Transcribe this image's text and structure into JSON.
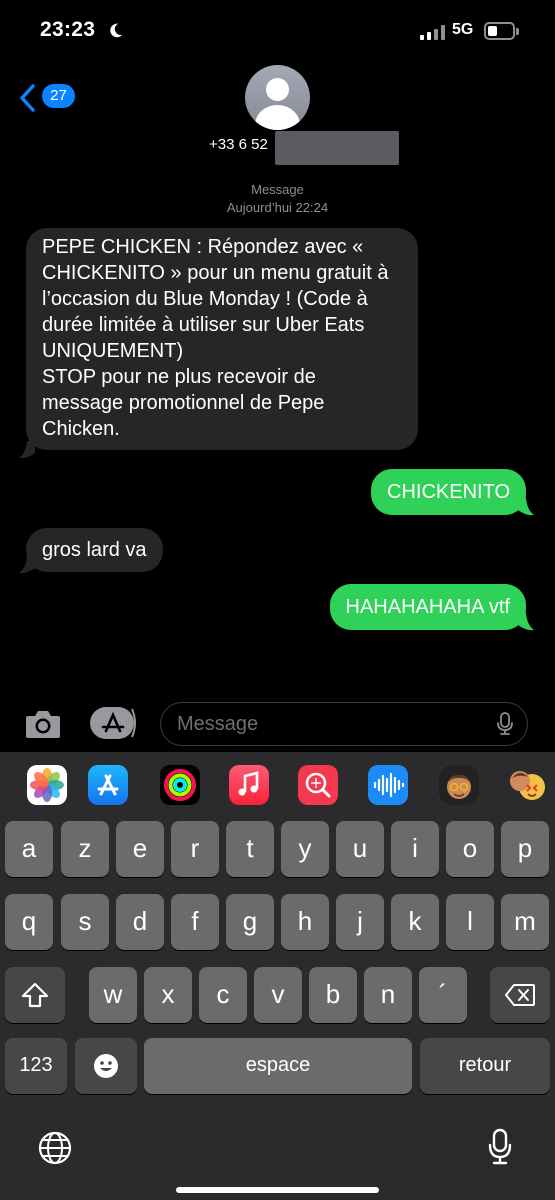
{
  "status_bar": {
    "time": "23:23",
    "network": "5G"
  },
  "header": {
    "unread_count": "27",
    "contact_number": "+33 6 52"
  },
  "thread": {
    "service": "Message",
    "timestamp": "Aujourd’hui 22:24",
    "messages": [
      {
        "direction": "incoming",
        "text": "PEPE CHICKEN : Répondez avec « CHICKENITO » pour un menu gratuit à l’occasion du Blue Monday ! (Code à durée limitée à utiliser sur Uber Eats UNIQUEMENT)\nSTOP pour ne plus recevoir de message promotionnel de Pepe Chicken."
      },
      {
        "direction": "outgoing",
        "text": "CHICKENITO"
      },
      {
        "direction": "incoming",
        "text": "gros lard va"
      },
      {
        "direction": "outgoing",
        "text": "HAHAHAHAHA vtf"
      }
    ]
  },
  "compose": {
    "placeholder": "Message"
  },
  "app_strip": [
    "photos-icon",
    "app-store-icon",
    "activity-icon",
    "music-icon",
    "images-search-icon",
    "audio-message-icon",
    "memoji-icon",
    "memoji-stickers-icon"
  ],
  "keyboard": {
    "row1": [
      "a",
      "z",
      "e",
      "r",
      "t",
      "y",
      "u",
      "i",
      "o",
      "p"
    ],
    "row2": [
      "q",
      "s",
      "d",
      "f",
      "g",
      "h",
      "j",
      "k",
      "l",
      "m"
    ],
    "row3": [
      "w",
      "x",
      "c",
      "v",
      "b",
      "n",
      "´"
    ],
    "numbers_label": "123",
    "space_label": "espace",
    "return_label": "retour"
  },
  "colors": {
    "outgoing_bubble": "#30d158",
    "incoming_bubble": "#262629",
    "badge": "#0a84ff"
  }
}
